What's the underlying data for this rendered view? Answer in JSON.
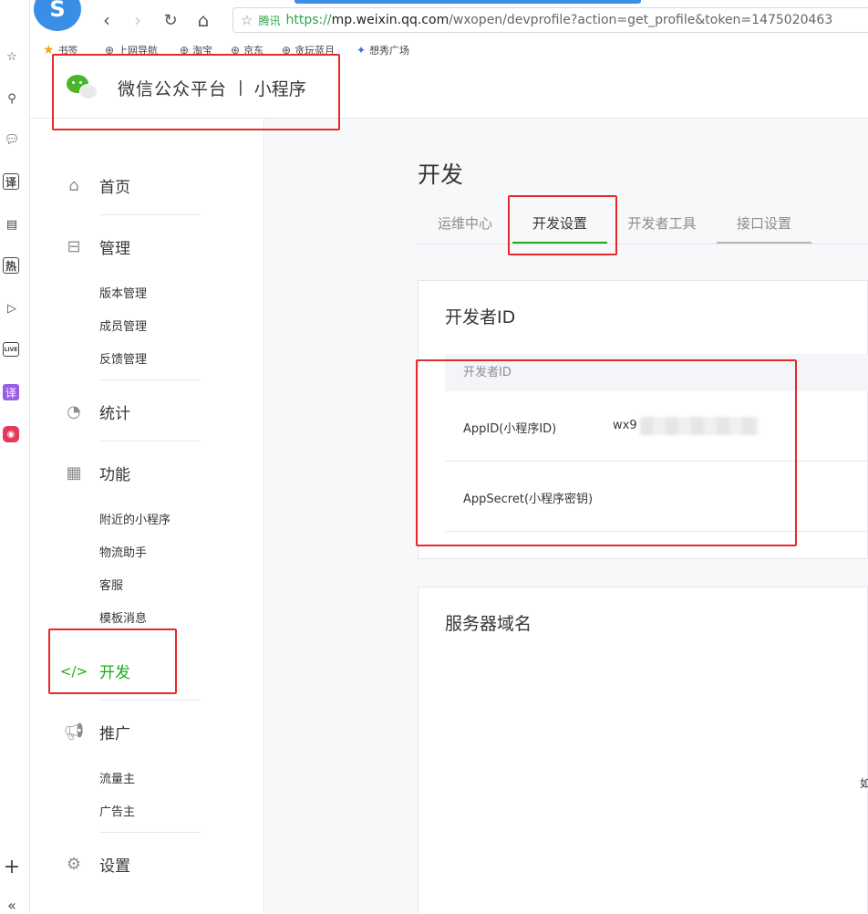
{
  "browser": {
    "logo_glyph": "S",
    "back": "‹",
    "forward": "›",
    "reload": "↻",
    "home": "⌂",
    "address": {
      "site_tag": "腾讯",
      "scheme": "https://",
      "host": "mp.weixin.qq.com",
      "path": "/wxopen/devprofile?action=get_profile&token=1475020463"
    },
    "bookmarks": [
      {
        "label": "书签"
      },
      {
        "label": "上网导航"
      },
      {
        "label": "淘宝"
      },
      {
        "label": "京东"
      },
      {
        "label": "贪玩蓝月"
      },
      {
        "label": "想秀广场"
      }
    ],
    "rail": {
      "boxed_1": "译",
      "boxed_2": "热",
      "live": "LIVE",
      "purple": "译",
      "plus": "+",
      "collapse": "«"
    }
  },
  "header": {
    "title": "微信公众平台",
    "separator": "|",
    "subtitle": "小程序"
  },
  "sidebar": {
    "home": "首页",
    "manage": "管理",
    "manage_subs": [
      "版本管理",
      "成员管理",
      "反馈管理"
    ],
    "stats": "统计",
    "features": "功能",
    "feature_subs": [
      "附近的小程序",
      "物流助手",
      "客服",
      "模板消息"
    ],
    "develop": "开发",
    "promote": "推广",
    "promote_subs": [
      "流量主",
      "广告主"
    ],
    "settings": "设置"
  },
  "main": {
    "title": "开发",
    "tabs": [
      "运维中心",
      "开发设置",
      "开发者工具",
      "接口设置"
    ],
    "active_tab": "开发设置",
    "developer_card": {
      "title": "开发者ID",
      "table_header": "开发者ID",
      "rows": [
        {
          "key": "AppID(小程序ID)",
          "value": "wx9"
        },
        {
          "key": "AppSecret(小程序密钥)",
          "value": ""
        }
      ]
    },
    "server_card": {
      "title": "服务器域名"
    },
    "edge_text": "如"
  },
  "colors": {
    "accent_green": "#1aad19",
    "highlight_red": "#e62a2a",
    "browser_blue": "#3a8ee6"
  }
}
